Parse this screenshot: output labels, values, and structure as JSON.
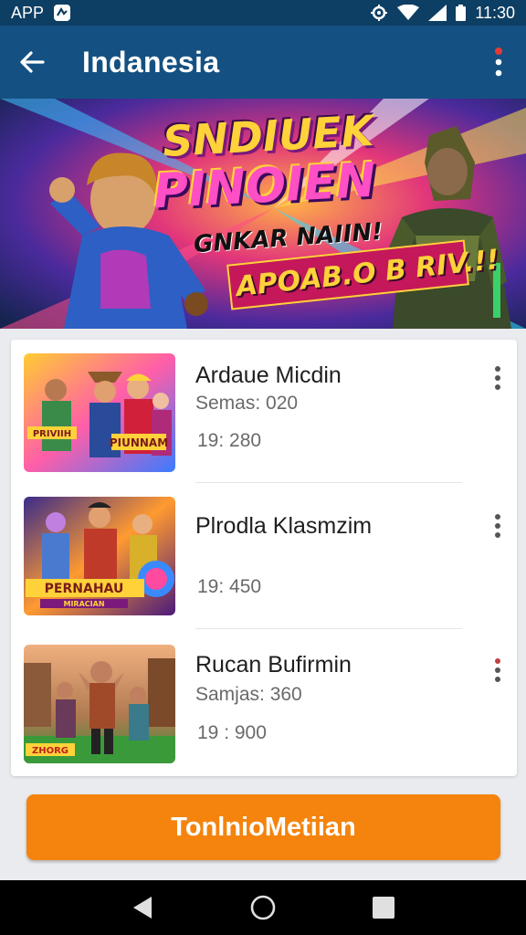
{
  "status_bar": {
    "app_label": "APP",
    "time": "11:30",
    "icons": [
      "app-notification-icon",
      "sync-icon",
      "wifi-icon",
      "signal-icon",
      "battery-icon"
    ]
  },
  "app_bar": {
    "title": "Indanesia",
    "icons": [
      "back-arrow-icon",
      "more-vert-icon"
    ],
    "accent_color": "#145182",
    "notification_dot_color": "#e53935"
  },
  "banner": {
    "line1": "SNDIUEK",
    "line2": "PINOIEN",
    "line3": "GNKAR NAIIN!",
    "line4": "APOAB.O B RIV.!!"
  },
  "list": {
    "items": [
      {
        "title": "Ardaue Micdin",
        "subtitle": "Semas: 020",
        "time": "19: 280"
      },
      {
        "title": "Plrodla Klasmzim",
        "subtitle": "",
        "time": "19: 450"
      },
      {
        "title": "Rucan Bufirmin",
        "subtitle": "Samjas: 360",
        "time": "19 : 900"
      }
    ],
    "thumb_captions": [
      "PRIVIIH",
      "PIUNNAM",
      "PERNAHAU",
      "MIRACIAN",
      "ZHORG"
    ]
  },
  "cta": {
    "label": "TonlnioMetiian",
    "color": "#f4840e"
  },
  "nav_bar": {
    "icons": [
      "nav-back-icon",
      "nav-home-icon",
      "nav-recents-icon"
    ]
  }
}
